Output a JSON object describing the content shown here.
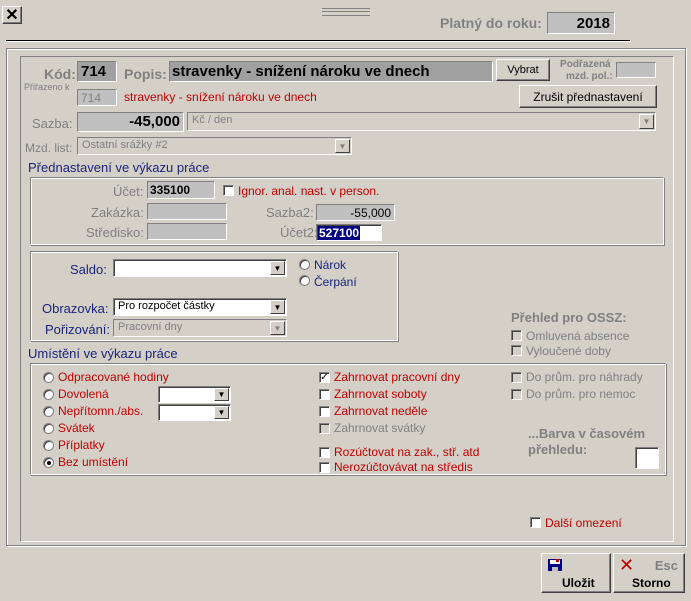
{
  "window": {
    "close_glyph": "✕",
    "valid_year_label": "Platný do roku:",
    "valid_year_value": "2018"
  },
  "header": {
    "kod_label": "Kód:",
    "kod_value": "714",
    "popis_label": "Popis:",
    "popis_value": "stravenky - snížení nároku ve dnech",
    "vybrat_label": "Vybrat",
    "podrazena_label_1": "Podřazená",
    "podrazena_label_2": "mzd. pol.:",
    "prirazeno_label": "Přiřazeno k",
    "prirazeno_kod": "714",
    "prirazeno_popis": "stravenky - snížení nároku ve dnech",
    "zrusit_label": "Zrušit přednastavení",
    "sazba_label": "Sazba:",
    "sazba_value": "-45,000",
    "unit_value": "Kč / den",
    "mzd_list_label": "Mzd. list:",
    "mzd_list_value": "Ostatní srážky #2"
  },
  "prednastaveni": {
    "title": "Přednastavení ve výkazu práce",
    "ucet_label": "Účet:",
    "ucet_value": "335100",
    "ignor_label": "Ignor. anal. nast. v person.",
    "zakazka_label": "Zakázka:",
    "stredisko_label": "Středisko:",
    "sazba2_label": "Sazba2:",
    "sazba2_value": "-55,000",
    "ucet2_label": "Účet2:",
    "ucet2_value": "527100"
  },
  "saldo": {
    "saldo_label": "Saldo:",
    "narok_label": "Nárok",
    "cerpani_label": "Čerpání",
    "obrazovka_label": "Obrazovka:",
    "obrazovka_value": "Pro rozpočet částky",
    "porizovani_label": "Pořizování:",
    "porizovani_value": "Pracovní dny"
  },
  "ossz": {
    "title": "Přehled pro OSSZ:",
    "omluvena_label": "Omluvená absence",
    "vyloucene_label": "Vyloučené doby"
  },
  "umisteni": {
    "title": "Umístění ve výkazu práce",
    "radios": [
      {
        "label": "Odpracované hodiny",
        "checked": false
      },
      {
        "label": "Dovolená",
        "checked": false
      },
      {
        "label": "Nepřítomn./abs.",
        "checked": false
      },
      {
        "label": "Svátek",
        "checked": false
      },
      {
        "label": "Příplatky",
        "checked": false
      },
      {
        "label": "Bez umístění",
        "checked": true
      }
    ],
    "zahrnovat_pracovni": "Zahrnovat pracovní dny",
    "zahrnovat_soboty": "Zahrnovat soboty",
    "zahrnovat_nedele": "Zahrnovat neděle",
    "zahrnovat_svatky": "Zahrnovat svátky",
    "rozuctovat": "Rozúčtovat na zak., stř. atd",
    "nerozuctovavat": "Nerozúčtovávat na středis",
    "do_prum_nahrady": "Do prům. pro náhrady",
    "do_prum_nemoc": "Do prům. pro nemoc",
    "barva_label_1": "...Barva v časovém",
    "barva_label_2": "přehledu:",
    "dalsi_omezeni": "Další omezení"
  },
  "footer": {
    "ulozit_label": "Uložit",
    "storno_label": "Storno",
    "esc_label": "Esc"
  },
  "colors": {
    "accent_blue": "#1a237e",
    "red_text": "#c00000",
    "selection": "#000080"
  }
}
